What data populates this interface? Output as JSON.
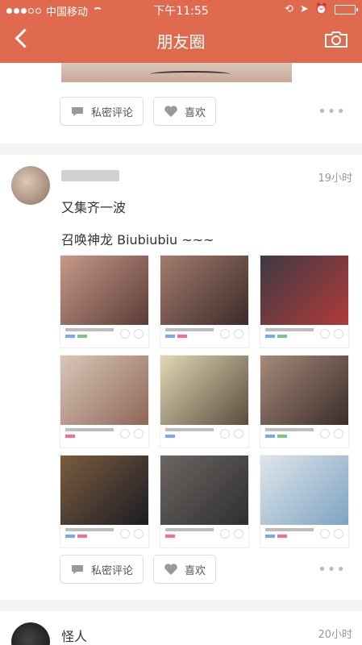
{
  "status": {
    "carrier": "中国移动",
    "time": "下午11:55"
  },
  "nav": {
    "title": "朋友圈"
  },
  "post1": {
    "private_comment": "私密评论",
    "like": "喜欢",
    "more": "•••"
  },
  "post2": {
    "time": "19小时",
    "text_line1": "又集齐一波",
    "text_line2": "召唤神龙 Biubiubiu ~~~",
    "private_comment": "私密评论",
    "like": "喜欢",
    "more": "•••"
  },
  "post3": {
    "name": "怪人",
    "time": "20小时"
  },
  "colors": {
    "accent": "#e06a4d"
  }
}
